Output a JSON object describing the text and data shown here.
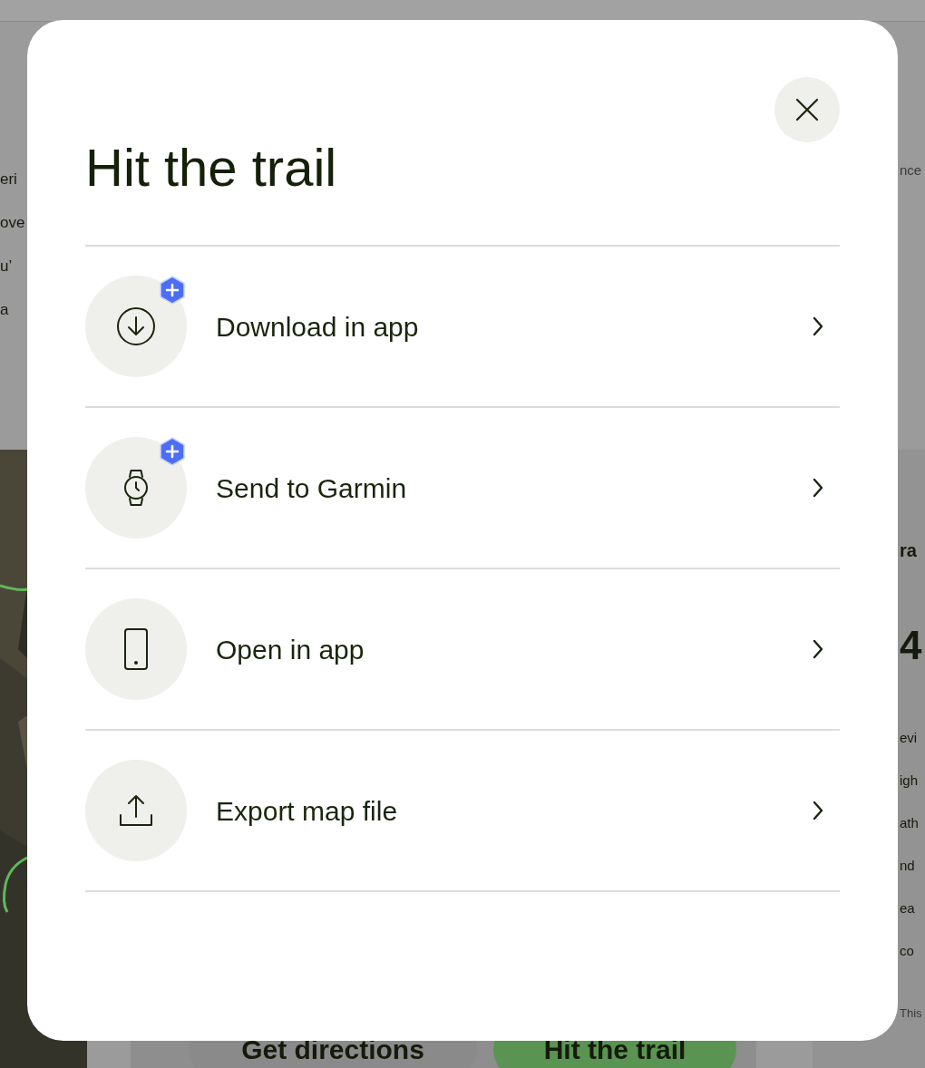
{
  "background": {
    "left_fragments": [
      "eri",
      "ove",
      "u’",
      "a"
    ],
    "right_fragment": "nce",
    "panel_heading": "ra",
    "panel_figure": "4",
    "panel_lines": [
      "evi",
      "igh",
      "ath",
      "nd",
      "ea",
      "co"
    ],
    "panel_footer": "This",
    "buttons": [
      {
        "label": "Get directions",
        "kind": "secondary"
      },
      {
        "label": "Hit the trail",
        "kind": "primary"
      }
    ]
  },
  "dialog": {
    "title": "Hit the trail",
    "items": [
      {
        "label": "Download in app",
        "kind": "download",
        "premium": true
      },
      {
        "label": "Send to Garmin",
        "kind": "watch",
        "premium": true
      },
      {
        "label": "Open in app",
        "kind": "phone",
        "premium": false
      },
      {
        "label": "Export map file",
        "kind": "export",
        "premium": false
      }
    ]
  }
}
